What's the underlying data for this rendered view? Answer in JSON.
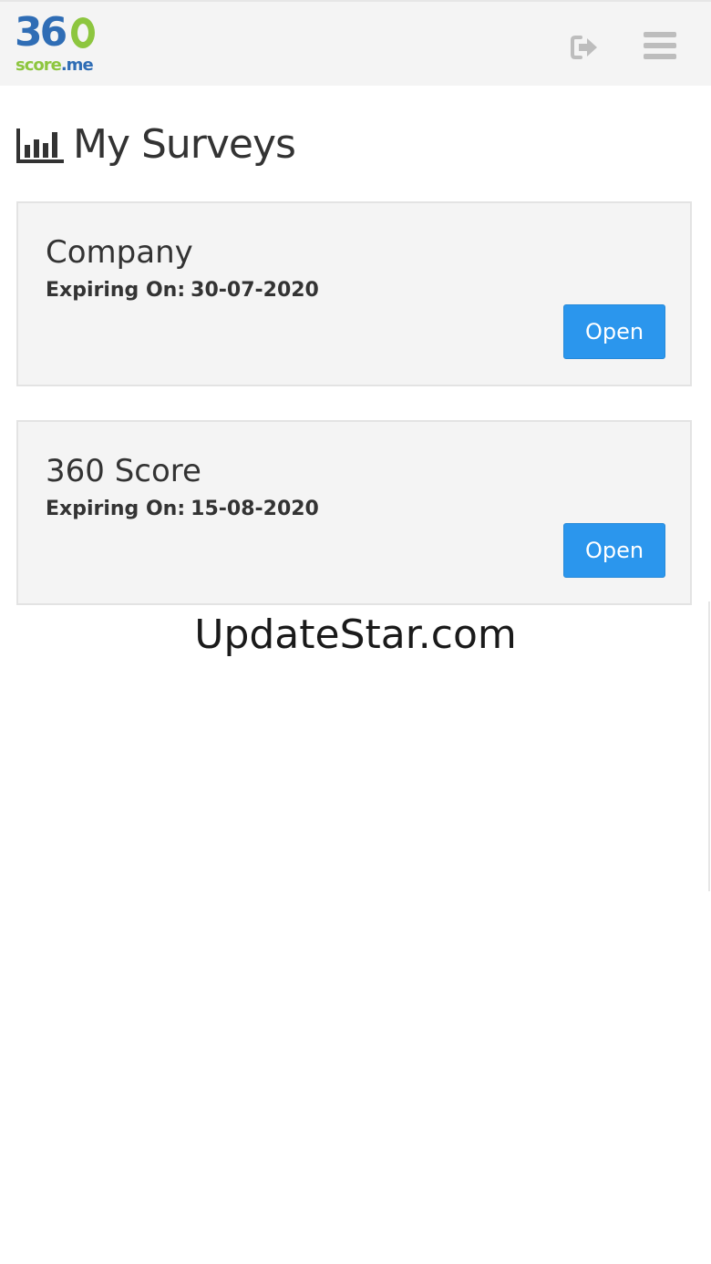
{
  "header": {
    "logo": {
      "top_text": "36",
      "bottom_score": "score",
      "bottom_me": ".me",
      "brand_blue": "#2f6db5",
      "brand_green": "#8dc63f"
    },
    "logout_icon": "sign-out-icon",
    "menu_icon": "hamburger-menu-icon"
  },
  "page": {
    "title": "My Surveys",
    "title_icon": "bar-chart-icon"
  },
  "surveys": [
    {
      "name": "Company",
      "expiry_label": "Expiring On:",
      "expiry_date": "30-07-2020",
      "button_label": "Open"
    },
    {
      "name": "360 Score",
      "expiry_label": "Expiring On:",
      "expiry_date": "15-08-2020",
      "button_label": "Open"
    }
  ],
  "watermark": "UpdateStar.com",
  "colors": {
    "header_bg": "#f4f4f4",
    "card_bg": "#f4f4f4",
    "button_bg": "#2b96ed",
    "icon_gray": "#bdbdbd"
  }
}
